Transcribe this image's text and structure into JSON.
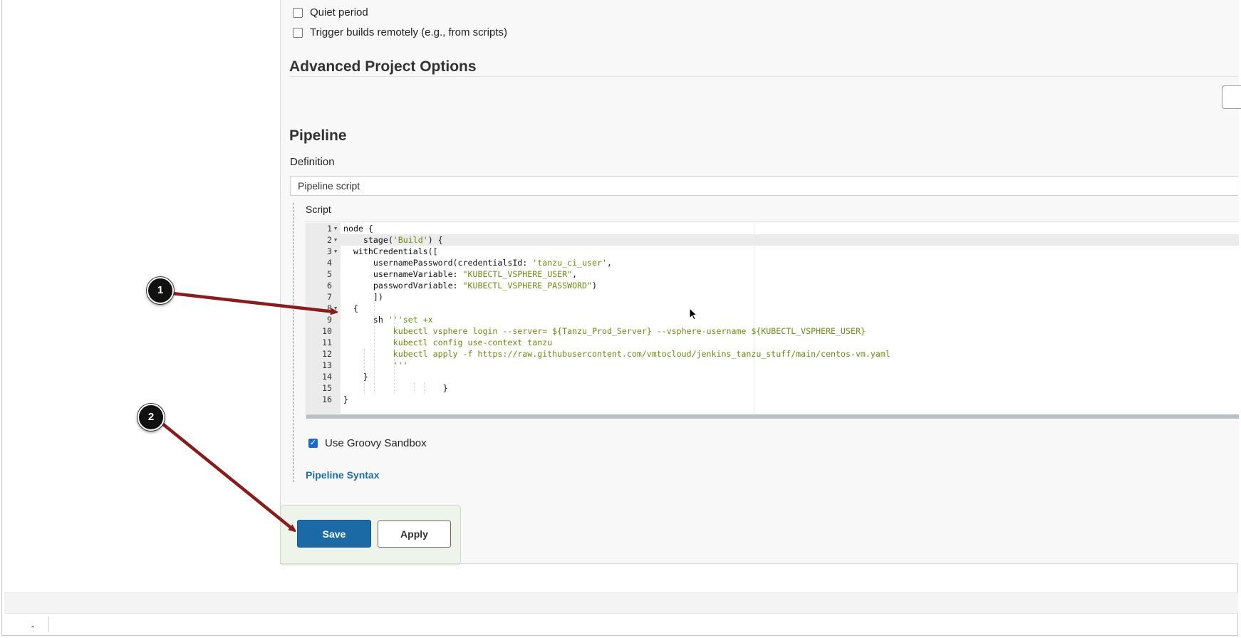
{
  "build_triggers": {
    "quiet_period_label": "Quiet period",
    "trigger_remotely_label": "Trigger builds remotely (e.g., from scripts)"
  },
  "advanced_project_options": {
    "title": "Advanced Project Options"
  },
  "pipeline": {
    "title": "Pipeline",
    "definition_label": "Definition",
    "definition_value": "Pipeline script",
    "script_label": "Script",
    "script_lines": [
      {
        "num": "1",
        "code": "node {"
      },
      {
        "num": "2",
        "code": "    stage('Build') {"
      },
      {
        "num": "3",
        "code": "  withCredentials(["
      },
      {
        "num": "4",
        "code": "      usernamePassword(credentialsId: 'tanzu_ci_user',"
      },
      {
        "num": "5",
        "code": "      usernameVariable: \"KUBECTL_VSPHERE_USER\","
      },
      {
        "num": "6",
        "code": "      passwordVariable: \"KUBECTL_VSPHERE_PASSWORD\")"
      },
      {
        "num": "7",
        "code": "      ])"
      },
      {
        "num": "8",
        "code": "  {"
      },
      {
        "num": "9",
        "code": "      sh '''set +x"
      },
      {
        "num": "10",
        "code": "          kubectl vsphere login --server= ${Tanzu_Prod_Server} --vsphere-username ${KUBECTL_VSPHERE_USER}"
      },
      {
        "num": "11",
        "code": "          kubectl config use-context tanzu"
      },
      {
        "num": "12",
        "code": "          kubectl apply -f https://raw.githubusercontent.com/vmtocloud/jenkins_tanzu_stuff/main/centos-vm.yaml"
      },
      {
        "num": "13",
        "code": "          '''"
      },
      {
        "num": "14",
        "code": "    }"
      },
      {
        "num": "15",
        "code": "                    }"
      },
      {
        "num": "16",
        "code": "}"
      }
    ],
    "use_groovy_sandbox_label": "Use Groovy Sandbox",
    "use_groovy_sandbox_checked": true,
    "pipeline_syntax_link": "Pipeline Syntax"
  },
  "buttons": {
    "save_label": "Save",
    "apply_label": "Apply"
  },
  "annotations": {
    "step_1": "1",
    "step_2": "2",
    "arrow_color": "#8b1a1a"
  },
  "colors": {
    "primary_button": "#1b6aa5",
    "link": "#1e6fa8",
    "string_literal": "#6a8c0b",
    "checkbox_checked": "#1a6bd1"
  }
}
